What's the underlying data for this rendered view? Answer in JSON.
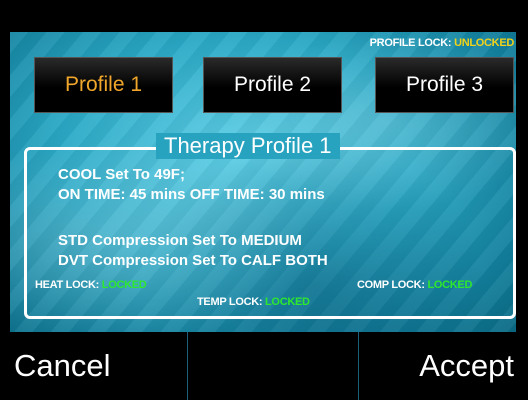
{
  "profile_lock": {
    "label": "PROFILE LOCK:",
    "state": "UNLOCKED"
  },
  "profiles": [
    {
      "label": "Profile 1",
      "selected": true
    },
    {
      "label": "Profile 2",
      "selected": false
    },
    {
      "label": "Profile 3",
      "selected": false
    }
  ],
  "panel": {
    "title": "Therapy Profile 1",
    "cool": "COOL Set To 49F;",
    "time": "ON TIME: 45 mins OFF TIME: 30 mins",
    "std": "STD Compression Set To MEDIUM",
    "dvt": "DVT Compression Set To CALF BOTH"
  },
  "locks": {
    "heat": {
      "label": "HEAT LOCK:",
      "state": "LOCKED"
    },
    "comp": {
      "label": "COMP LOCK:",
      "state": "LOCKED"
    },
    "temp": {
      "label": "TEMP LOCK:",
      "state": "LOCKED"
    }
  },
  "actions": {
    "cancel": "Cancel",
    "accept": "Accept"
  },
  "colors": {
    "selected_profile": "#f0a62a",
    "locked": "#2ee82e",
    "unlocked": "#f2d21a"
  }
}
